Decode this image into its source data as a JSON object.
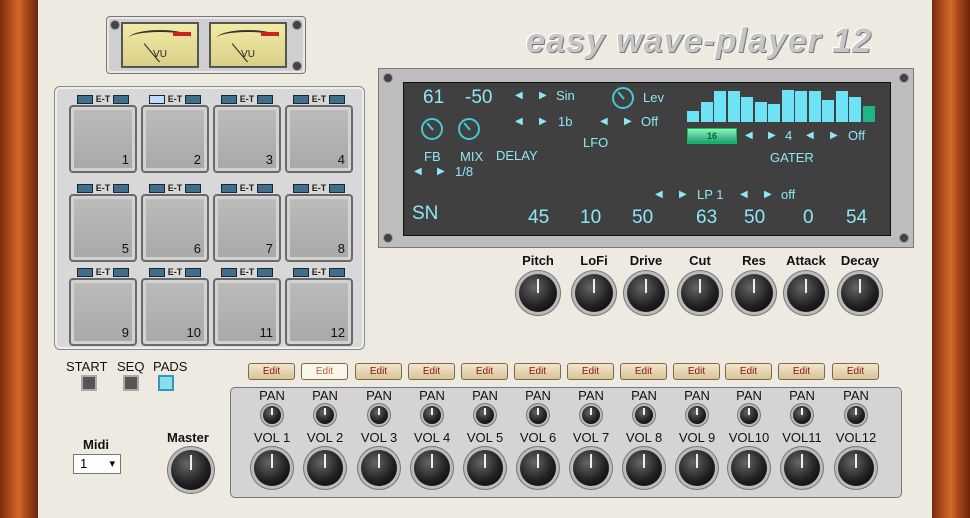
{
  "meters": {
    "left_label": "VU",
    "right_label": "VU"
  },
  "logo": "easy wave-player 12",
  "pads": [
    {
      "num": "1",
      "et": "E-T",
      "on": false
    },
    {
      "num": "2",
      "et": "E-T",
      "on": true
    },
    {
      "num": "3",
      "et": "E-T",
      "on": false
    },
    {
      "num": "4",
      "et": "E-T",
      "on": false
    },
    {
      "num": "5",
      "et": "E-T",
      "on": false
    },
    {
      "num": "6",
      "et": "E-T",
      "on": false
    },
    {
      "num": "7",
      "et": "E-T",
      "on": false
    },
    {
      "num": "8",
      "et": "E-T",
      "on": false
    },
    {
      "num": "9",
      "et": "E-T",
      "on": false
    },
    {
      "num": "10",
      "et": "E-T",
      "on": false
    },
    {
      "num": "11",
      "et": "E-T",
      "on": false
    },
    {
      "num": "12",
      "et": "E-T",
      "on": false
    }
  ],
  "display": {
    "fb_value": "61",
    "mix_value": "-50",
    "fb_label": "FB",
    "mix_label": "MIX",
    "delay_label": "DELAY",
    "delay_time": "1/8",
    "lfo_wave": "Sin",
    "lfo_rate": "1b",
    "lfo_dest": "Lev",
    "lfo_state": "Off",
    "lfo_label": "LFO",
    "gater_steps": "16",
    "gater_value": "4",
    "gater_state": "Off",
    "gater_label": "GATER",
    "gater_levels": [
      0.3,
      0.55,
      0.85,
      0.85,
      0.7,
      0.55,
      0.5,
      0.9,
      0.85,
      0.85,
      0.6,
      0.85,
      0.7,
      0.45
    ],
    "filter_type": "LP 1",
    "filter_state": "off",
    "sample": "SN",
    "values": [
      "45",
      "10",
      "50",
      "63",
      "50",
      "0",
      "54"
    ]
  },
  "knobs": [
    "Pitch",
    "LoFi",
    "Drive",
    "Cut",
    "Res",
    "Attack",
    "Decay"
  ],
  "controls": {
    "start": "START",
    "seq": "SEQ",
    "pads": "PADS"
  },
  "edit_label": "Edit",
  "edit_active": 1,
  "channels": [
    {
      "pan": "PAN",
      "vol": "VOL 1"
    },
    {
      "pan": "PAN",
      "vol": "VOL 2"
    },
    {
      "pan": "PAN",
      "vol": "VOL 3"
    },
    {
      "pan": "PAN",
      "vol": "VOL 4"
    },
    {
      "pan": "PAN",
      "vol": "VOL 5"
    },
    {
      "pan": "PAN",
      "vol": "VOL 6"
    },
    {
      "pan": "PAN",
      "vol": "VOL 7"
    },
    {
      "pan": "PAN",
      "vol": "VOL 8"
    },
    {
      "pan": "PAN",
      "vol": "VOL 9"
    },
    {
      "pan": "PAN",
      "vol": "VOL10"
    },
    {
      "pan": "PAN",
      "vol": "VOL11"
    },
    {
      "pan": "PAN",
      "vol": "VOL12"
    }
  ],
  "midi": {
    "label": "Midi",
    "value": "1"
  },
  "master": "Master"
}
